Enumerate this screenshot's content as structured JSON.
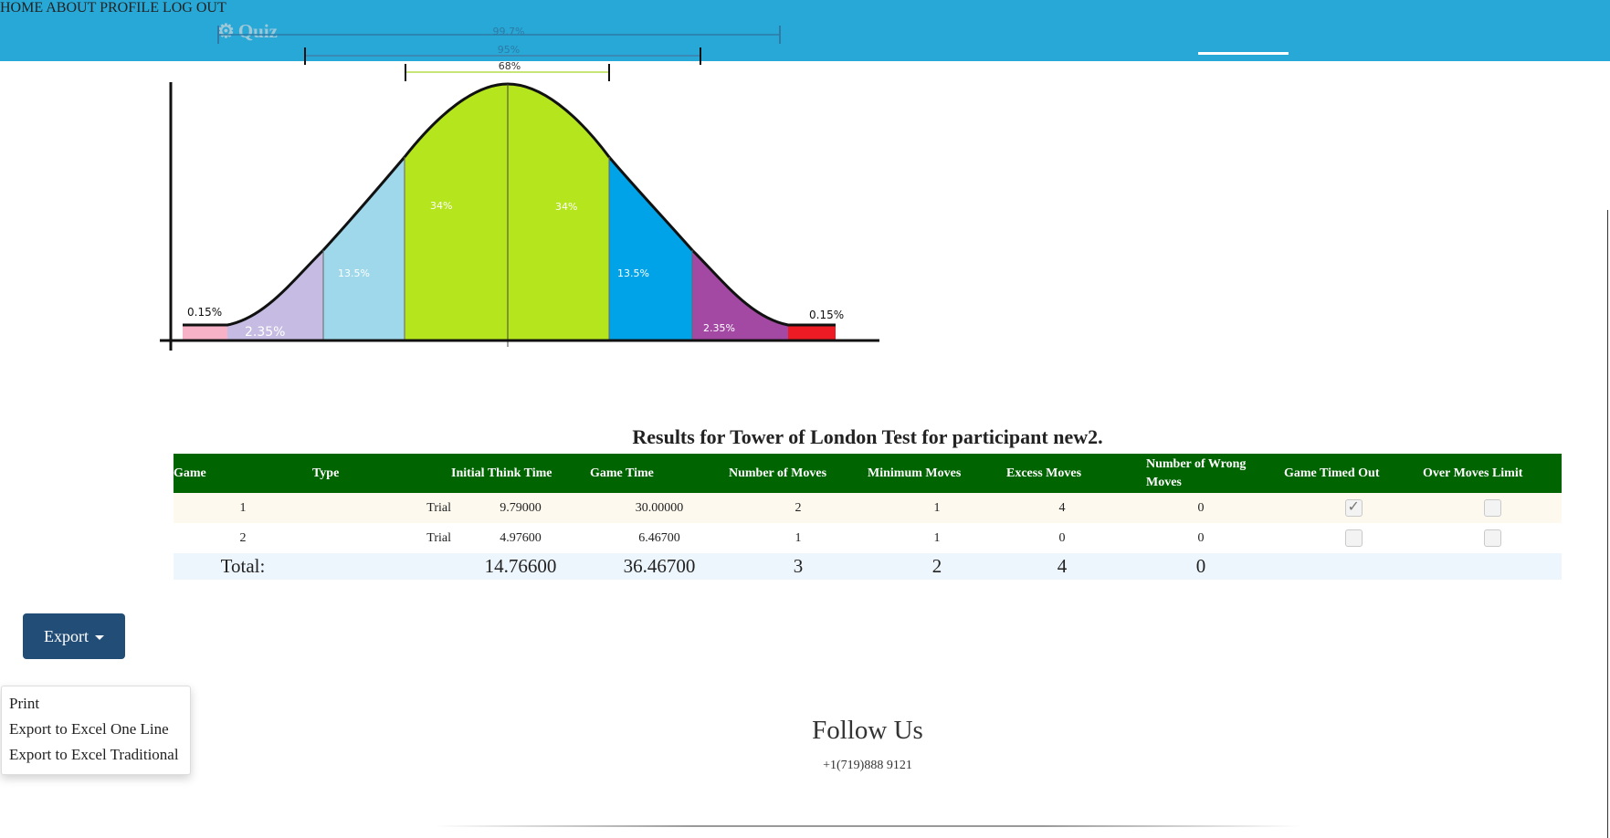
{
  "header": {
    "brand": "Quiz",
    "brand_icon": "gears-icon",
    "nav": [
      "HOME",
      "ABOUT",
      "PROFILE",
      "LOG OUT"
    ],
    "active_nav": "ABOUT"
  },
  "bell_curve": {
    "bands": [
      "99.7%",
      "95%",
      "68%"
    ],
    "segments": [
      "0.15%",
      "2.35%",
      "13.5%",
      "34%",
      "34%",
      "13.5%",
      "2.35%",
      "0.15%"
    ],
    "colors": {
      "far_tail_left": "#f7b2c7",
      "left_2": "#c6bce3",
      "left_1": "#9ed8ea",
      "center": "#b5e61d",
      "right_1": "#00a2e8",
      "right_2": "#a349a4",
      "far_tail_right": "#ed1c24",
      "band_68": "#c8e678",
      "band_95": "#3a88b4",
      "band_997": "#2f7aa6"
    }
  },
  "results": {
    "title": "Results for Tower of London Test for participant new2.",
    "columns": [
      "Game",
      "Type",
      "Initial Think Time",
      "Game Time",
      "Number of Moves",
      "Minimum Moves",
      "Excess Moves",
      "Number of Wrong Moves",
      "Game Timed Out",
      "Over Moves Limit"
    ],
    "rows": [
      {
        "game": "1",
        "type": "Trial",
        "think": "9.79000",
        "time": "30.00000",
        "moves": "2",
        "min": "1",
        "excess": "4",
        "wrong": "0",
        "timed_out": true,
        "over_limit": false
      },
      {
        "game": "2",
        "type": "Trial",
        "think": "4.97600",
        "time": "6.46700",
        "moves": "1",
        "min": "1",
        "excess": "0",
        "wrong": "0",
        "timed_out": false,
        "over_limit": false
      }
    ],
    "total": {
      "label": "Total:",
      "think": "14.76600",
      "time": "36.46700",
      "moves": "3",
      "min": "2",
      "excess": "4",
      "wrong": "0"
    },
    "header_color": "#006400"
  },
  "export": {
    "button_label": "Export",
    "menu": [
      "Print",
      "Export to Excel One Line",
      "Export to Excel Traditional"
    ]
  },
  "footer": {
    "heading": "Follow Us",
    "phone": "+1(719)888 9121"
  }
}
